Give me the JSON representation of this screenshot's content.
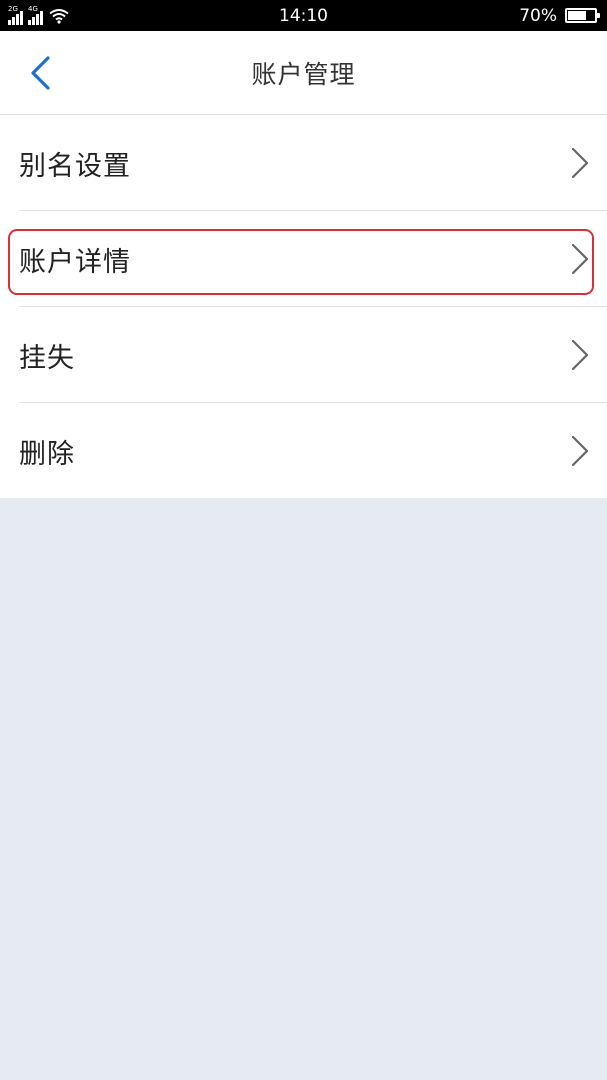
{
  "status_bar": {
    "network_1": "2G",
    "network_2": "4G",
    "time": "14:10",
    "battery": "70%",
    "battery_level": 0.7
  },
  "nav": {
    "title": "账户管理",
    "back_icon": "chevron-left-icon"
  },
  "menu": {
    "items": [
      {
        "label": "别名设置"
      },
      {
        "label": "账户详情"
      },
      {
        "label": "挂失"
      },
      {
        "label": "删除"
      }
    ]
  },
  "colors": {
    "accent": "#1e6fd2",
    "highlight": "#d9303a",
    "page_bg": "#e6ebf2"
  }
}
